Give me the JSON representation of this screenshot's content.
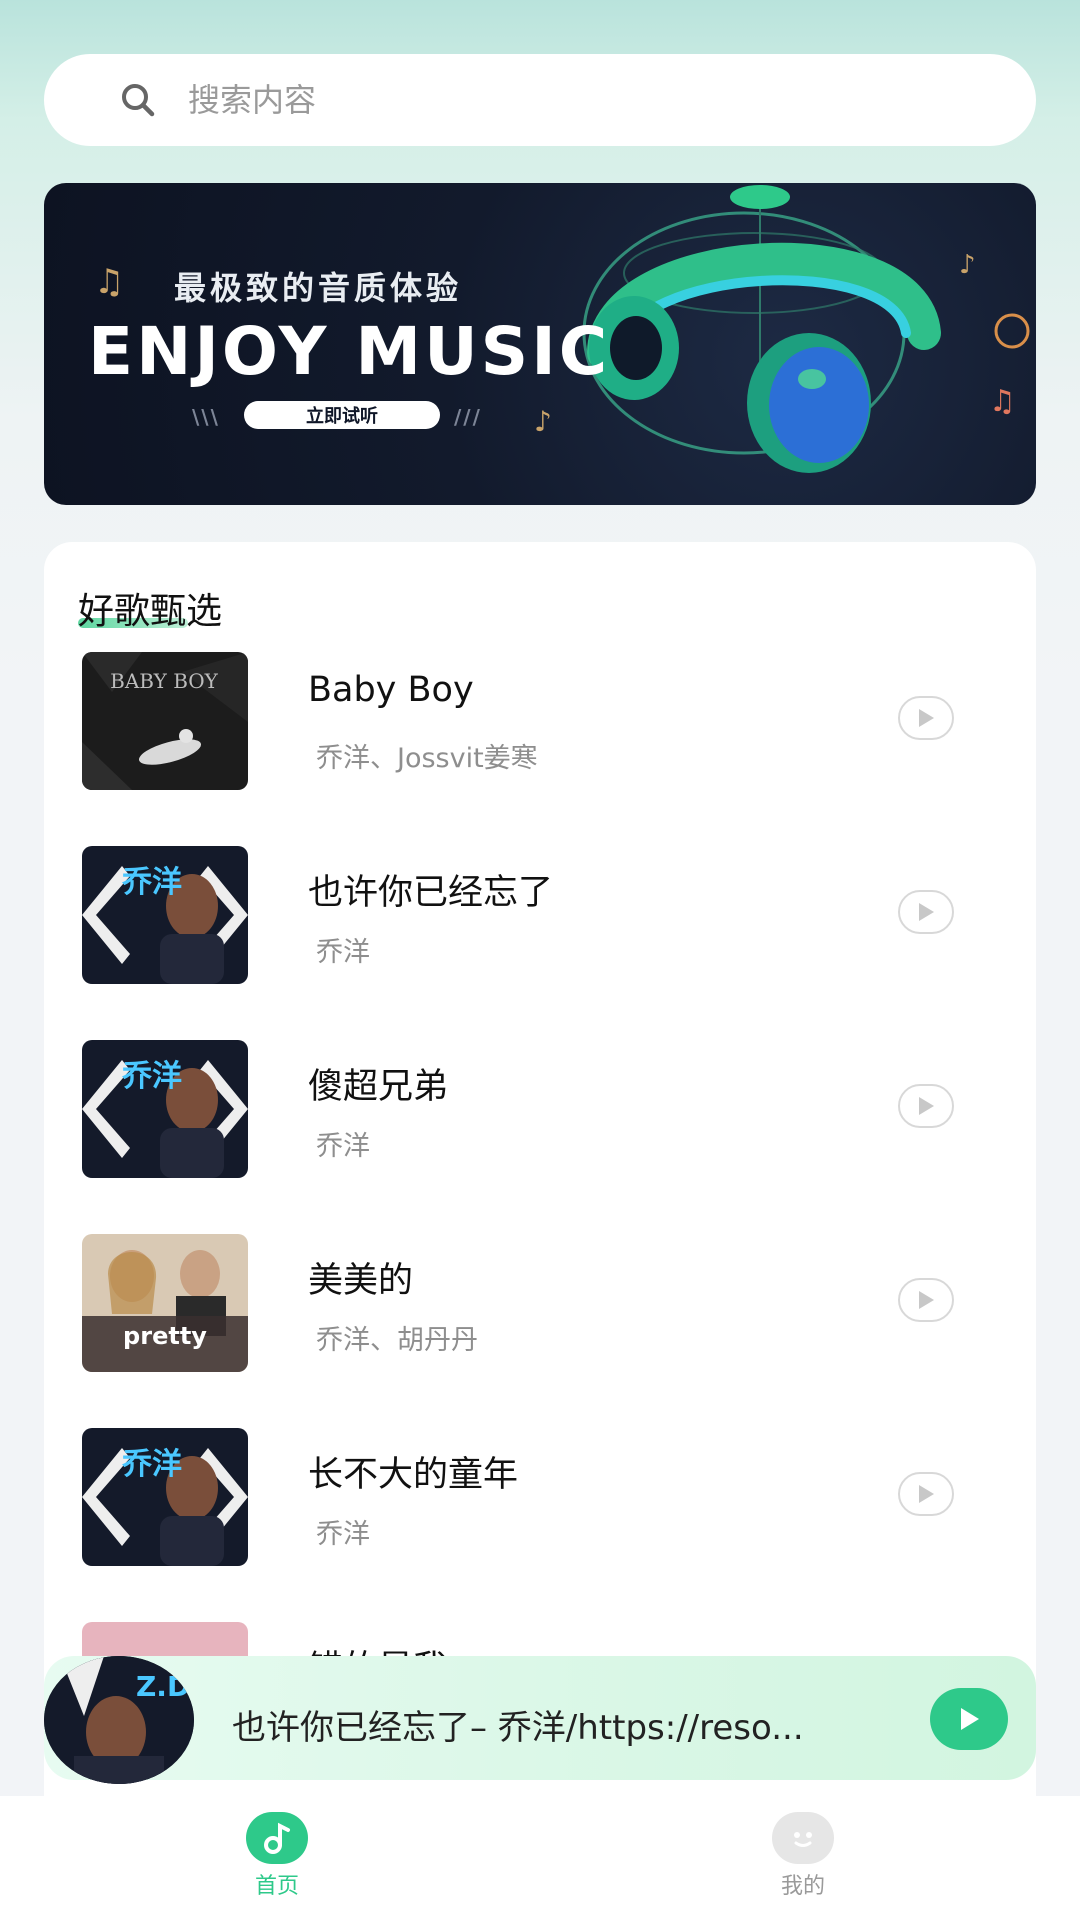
{
  "search": {
    "placeholder": "搜索内容",
    "icon": "search-icon"
  },
  "banner": {
    "subtitle": "最极致的音质体验",
    "headline": "ENJOY MUSIC",
    "button_label": "立即试听",
    "left_marks": "\\\\\\",
    "right_marks": "///"
  },
  "section": {
    "title": "好歌甄选"
  },
  "songs": [
    {
      "title": "Baby Boy",
      "artist": "乔洋、Jossvit姜寒",
      "cover_text": "BABY BOY"
    },
    {
      "title": "也许你已经忘了",
      "artist": "乔洋",
      "cover_text": "乔洋"
    },
    {
      "title": "傻超兄弟",
      "artist": "乔洋",
      "cover_text": "乔洋"
    },
    {
      "title": "美美的",
      "artist": "乔洋、胡丹丹",
      "cover_text": "pretty"
    },
    {
      "title": "长不大的童年",
      "artist": "乔洋",
      "cover_text": "乔洋"
    },
    {
      "title": "错的是我",
      "artist": "",
      "cover_text": ""
    }
  ],
  "now_playing": {
    "text": "也许你已经忘了– 乔洋/https://reso..."
  },
  "tabs": [
    {
      "label": "首页",
      "icon": "music-note-icon",
      "active": true
    },
    {
      "label": "我的",
      "icon": "face-icon",
      "active": false
    }
  ],
  "colors": {
    "accent": "#2ec98a",
    "tab_active": "#2ec98a",
    "tab_inactive": "#9a9a9a"
  }
}
